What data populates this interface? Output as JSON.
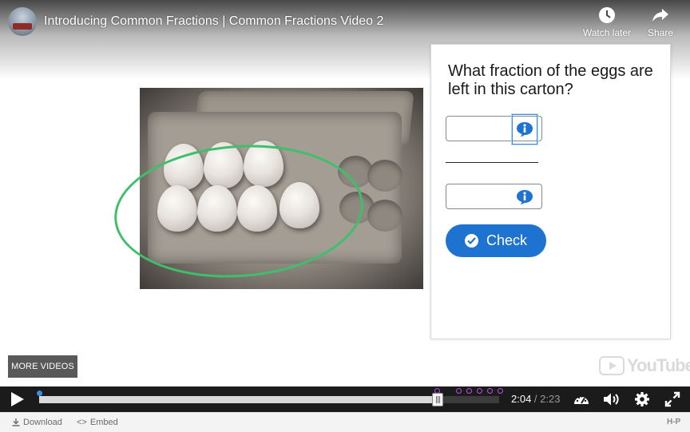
{
  "video": {
    "title": "Introducing Common Fractions | Common Fractions Video 2",
    "watch_later_label": "Watch later",
    "share_label": "Share",
    "more_videos_label": "MORE VIDEOS",
    "youtube_wordmark": "YouTube"
  },
  "quiz": {
    "question": "What fraction of the eggs are left in this carton?",
    "numerator_value": "",
    "denominator_value": "",
    "tip_icon": "info-speech-bubble-icon",
    "check_label": "Check",
    "check_icon": "checkmark-circle-icon"
  },
  "player": {
    "current_time": "2:04",
    "separator": " / ",
    "duration": "2:23",
    "progress_fraction": 0.867,
    "marker_count": 6,
    "icons": [
      "play-icon",
      "playback-speed-icon",
      "volume-icon",
      "settings-gear-icon",
      "fullscreen-icon"
    ]
  },
  "footer": {
    "download_label": "Download",
    "embed_label": "Embed",
    "embed_prefix": "<>",
    "brand": "H-P"
  },
  "colors": {
    "accent": "#1f73d0",
    "highlight_ellipse": "#3fbf6b",
    "interaction_marker": "#b84fe0",
    "control_bar": "#1b1b1b"
  }
}
